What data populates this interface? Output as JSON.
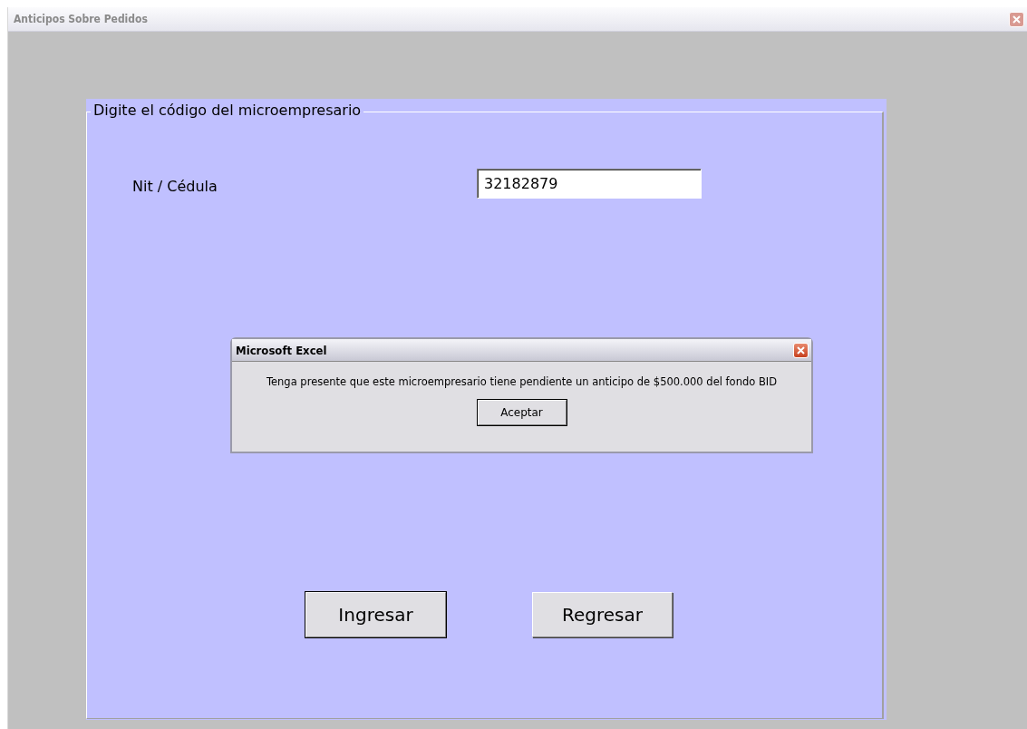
{
  "window": {
    "title": "Anticipos Sobre Pedidos"
  },
  "group": {
    "legend": "Digite el código del microempresario"
  },
  "field": {
    "label": "Nit / Cédula",
    "value": "32182879"
  },
  "buttons": [
    {
      "label": "Ingresar",
      "default": true
    },
    {
      "label": "Regresar",
      "default": false
    }
  ],
  "dialog": {
    "title": "Microsoft Excel",
    "message": "Tenga presente que este microempresario tiene pendiente un anticipo de $500.000 del fondo BID",
    "button": "Aceptar"
  }
}
